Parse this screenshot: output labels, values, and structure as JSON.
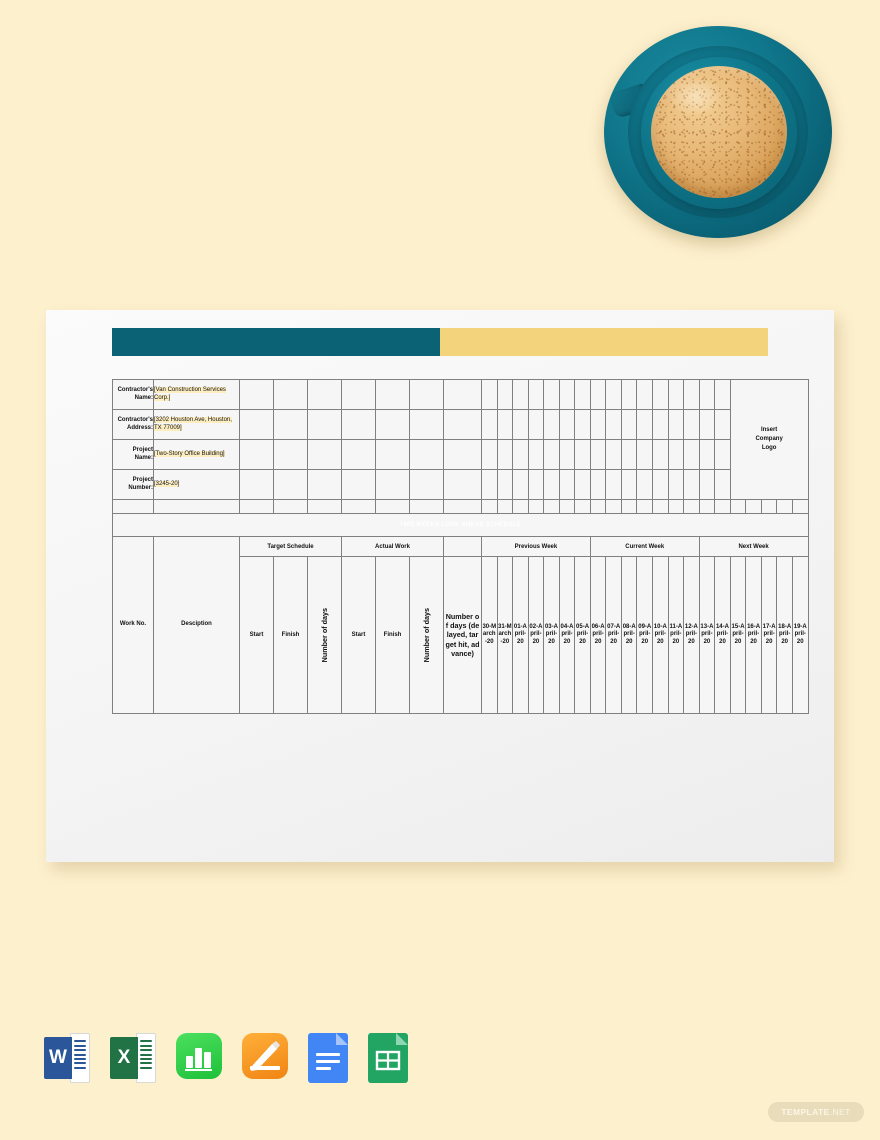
{
  "document": {
    "title": "TWO WEEKS LOOK AHEAD SCHEDULE",
    "logo_placeholder": "Insert Company Logo"
  },
  "colors": {
    "page_background": "#fdf0cd",
    "paper": "#f6f6f6",
    "teal": "#0b6274",
    "gold": "#f0cf7d",
    "cream": "#f3ecda",
    "highlight": "#fdeec2",
    "grid_line": "#808080"
  },
  "info_fields": [
    {
      "label": "Contractor's Name:",
      "value": "[Van Construction Services Corp.]"
    },
    {
      "label": "Contractor's Address:",
      "value": "[3202 Houston Ave, Houston, TX 77009]"
    },
    {
      "label": "Project Name:",
      "value": "[Two-Story Office Building]"
    },
    {
      "label": "Project Number:",
      "value": "[3245-20]"
    }
  ],
  "table": {
    "group_headers": [
      {
        "label": "Target Schedule",
        "span": 3
      },
      {
        "label": "Actual Work",
        "span": 3
      },
      {
        "label": "Previous Week",
        "span": 7
      },
      {
        "label": "Current Week",
        "span": 7
      },
      {
        "label": "Next Week",
        "span": 7
      }
    ],
    "left_headers": [
      {
        "label": "Work No."
      },
      {
        "label": "Desciption"
      }
    ],
    "sub_headers": [
      {
        "label": "Start",
        "rotated": false
      },
      {
        "label": "Finish",
        "rotated": false
      },
      {
        "label": "Number of days",
        "rotated": true
      },
      {
        "label": "Start",
        "rotated": false
      },
      {
        "label": "Finish",
        "rotated": false
      },
      {
        "label": "Number of days",
        "rotated": true
      },
      {
        "label": "Number of days (delayed, target hit, advance)",
        "rotated": false,
        "gold": true
      }
    ],
    "date_columns": [
      "30-March-20",
      "31-March-20",
      "01-April-20",
      "02-April-20",
      "03-April-20",
      "04-April-20",
      "05-April-20",
      "06-April-20",
      "07-April-20",
      "08-April-20",
      "09-April-20",
      "10-April-20",
      "11-April-20",
      "12-April-20",
      "13-April-20",
      "14-April-20",
      "15-April-20",
      "16-April-20",
      "17-April-20",
      "18-April-20",
      "19-April-20"
    ]
  },
  "app_icons": [
    {
      "name": "microsoft-word",
      "letter": "W",
      "color": "#2b579a"
    },
    {
      "name": "microsoft-excel",
      "letter": "X",
      "color": "#217346"
    },
    {
      "name": "apple-numbers",
      "letter": "",
      "color": "#2fc84b"
    },
    {
      "name": "apple-pages",
      "letter": "",
      "color": "#f79a1e"
    },
    {
      "name": "google-docs",
      "letter": "",
      "color": "#4285f4"
    },
    {
      "name": "google-sheets",
      "letter": "",
      "color": "#22a463"
    }
  ],
  "watermark": {
    "brand": "TEMPLATE",
    "suffix": ".NET"
  }
}
